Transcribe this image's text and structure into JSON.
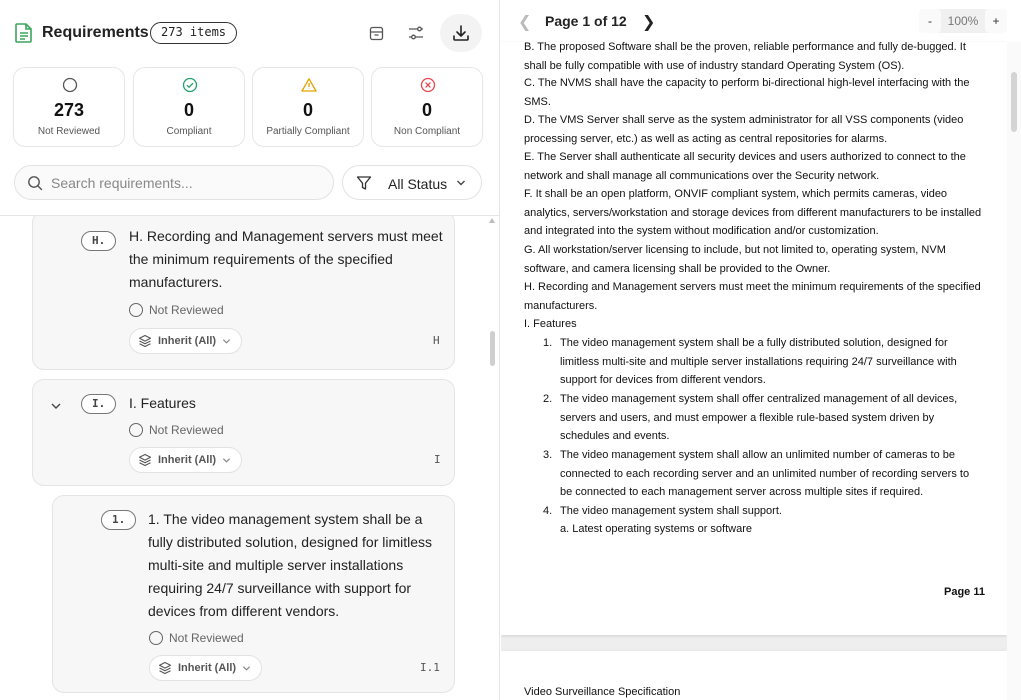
{
  "header": {
    "title": "Requirements",
    "count_badge": "273 items"
  },
  "stats": [
    {
      "value": "273",
      "label": "Not Reviewed",
      "icon": "circle-icon",
      "color": "#555555"
    },
    {
      "value": "0",
      "label": "Compliant",
      "icon": "check-circle-icon",
      "color": "#22a06b"
    },
    {
      "value": "0",
      "label": "Partially Compliant",
      "icon": "warning-triangle-icon",
      "color": "#e0a100"
    },
    {
      "value": "0",
      "label": "Non Compliant",
      "icon": "x-circle-icon",
      "color": "#e5484d"
    }
  ],
  "search": {
    "placeholder": "Search requirements..."
  },
  "filter": {
    "label": "All Status"
  },
  "requirements": [
    {
      "badge": "H.",
      "text": "H. Recording and Management servers must meet the minimum requirements of the specified manufacturers.",
      "status": "Not Reviewed",
      "inherit": "Inherit (All)",
      "code": "H"
    },
    {
      "badge": "I.",
      "text": "I. Features",
      "status": "Not Reviewed",
      "inherit": "Inherit (All)",
      "code": "I"
    },
    {
      "badge": "1.",
      "text": "1. The video management system shall be a fully distributed solution, designed for limitless multi-site and multiple server installations requiring 24/7 surveillance with support for devices from different vendors.",
      "status": "Not Reviewed",
      "inherit": "Inherit (All)",
      "code": "I.1"
    }
  ],
  "viewer": {
    "page_label": "Page 1 of 12",
    "zoom": "100%",
    "zoom_minus": "-",
    "zoom_plus": "+",
    "paragraphs": [
      "B. The proposed Software shall be the proven, reliable performance and fully de-bugged. It shall be fully compatible with use of industry standard Operating System (OS).",
      "C. The NVMS shall have the capacity to perform bi-directional high-level interfacing with the SMS.",
      "D. The VMS Server shall serve as the system administrator for all VSS components (video processing server, etc.) as well as acting as central repositories for alarms.",
      "E. The Server shall authenticate all security devices and users authorized to connect to the network and shall manage all communications over the Security network.",
      "F. It shall be an open platform, ONVIF compliant system, which permits cameras, video analytics, servers/workstation and storage devices from different manufacturers to be installed and integrated into the system without modification and/or customization.",
      "G. All workstation/server licensing to include, but not limited to, operating system, NVM software, and camera licensing shall be provided to the Owner.",
      "H. Recording and Management servers must meet the minimum requirements of the specified manufacturers.",
      "I. Features"
    ],
    "list_items": [
      {
        "num": "1.",
        "text": "The video management system shall be a fully distributed solution, designed for limitless multi-site and multiple server installations requiring 24/7 surveillance with support for devices from different vendors."
      },
      {
        "num": "2.",
        "text": "The video management system shall offer centralized management of all devices, servers and users, and must empower a flexible rule-based system driven by schedules and events."
      },
      {
        "num": "3.",
        "text": "The video management system shall allow an unlimited number of cameras to be connected to each recording server and an unlimited number of recording servers to be connected to each management server across multiple sites if required."
      },
      {
        "num": "4.",
        "text": "The video management system shall support."
      }
    ],
    "sub_item": "a. Latest operating systems or software",
    "page_footer": "Page 11",
    "next_page_header": "Video Surveillance Specification"
  }
}
